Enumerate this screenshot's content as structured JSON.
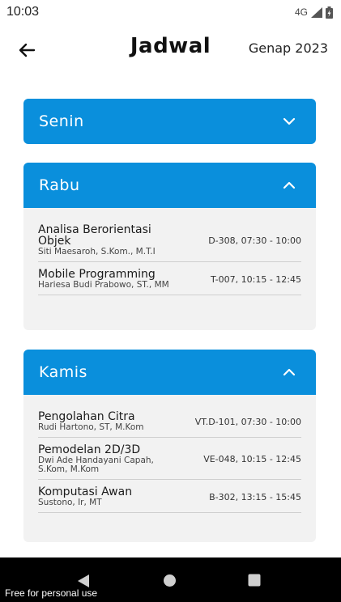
{
  "status_bar": {
    "time": "10:03",
    "network": "4G"
  },
  "header": {
    "title": "Jadwal",
    "semester": "Genap 2023"
  },
  "days": [
    {
      "label": "Senin",
      "expanded": false,
      "courses": []
    },
    {
      "label": "Rabu",
      "expanded": true,
      "courses": [
        {
          "name": "Analisa Berorientasi Objek",
          "lecturer": "Siti Maesaroh, S.Kom., M.T.I",
          "room_time": "D-308, 07:30 - 10:00"
        },
        {
          "name": "Mobile Programming",
          "lecturer": "Hariesa Budi Prabowo, ST., MM",
          "room_time": "T-007, 10:15 - 12:45"
        }
      ]
    },
    {
      "label": "Kamis",
      "expanded": true,
      "courses": [
        {
          "name": "Pengolahan Citra",
          "lecturer": "Rudi Hartono, ST, M.Kom",
          "room_time": "VT.D-101, 07:30 - 10:00"
        },
        {
          "name": "Pemodelan 2D/3D",
          "lecturer": "Dwi Ade Handayani Capah, S.Kom, M.Kom",
          "room_time": "VE-048, 10:15 - 12:45"
        },
        {
          "name": "Komputasi Awan",
          "lecturer": "Sustono, Ir, MT",
          "room_time": "B-302, 13:15 - 15:45"
        }
      ]
    }
  ],
  "watermark": "Free for personal use",
  "colors": {
    "accent": "#0a8fdc",
    "card_body": "#f2f2f2"
  },
  "icons": {
    "back": "arrow-left-icon",
    "collapsed": "chevron-down-icon",
    "expanded": "chevron-up-icon"
  }
}
